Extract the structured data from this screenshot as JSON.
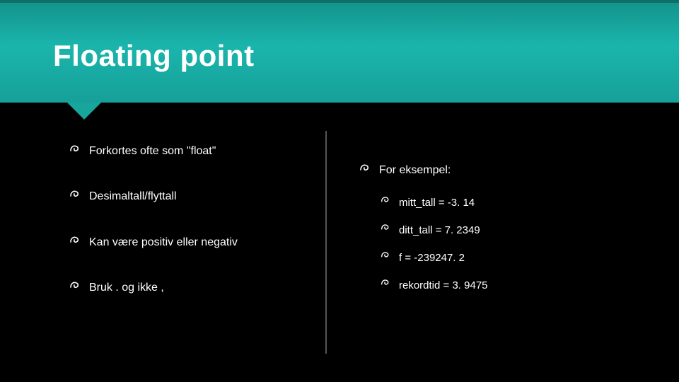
{
  "title": "Floating point",
  "left_bullets": [
    "Forkortes ofte som \"float\"",
    "Desimaltall/flyttall",
    "Kan være positiv eller negativ",
    "Bruk . og ikke ,"
  ],
  "right_lead": "For eksempel:",
  "right_sub": [
    "mitt_tall = -3. 14",
    "ditt_tall = 7. 2349",
    "f = -239247. 2",
    "rekordtid = 3. 9475"
  ]
}
